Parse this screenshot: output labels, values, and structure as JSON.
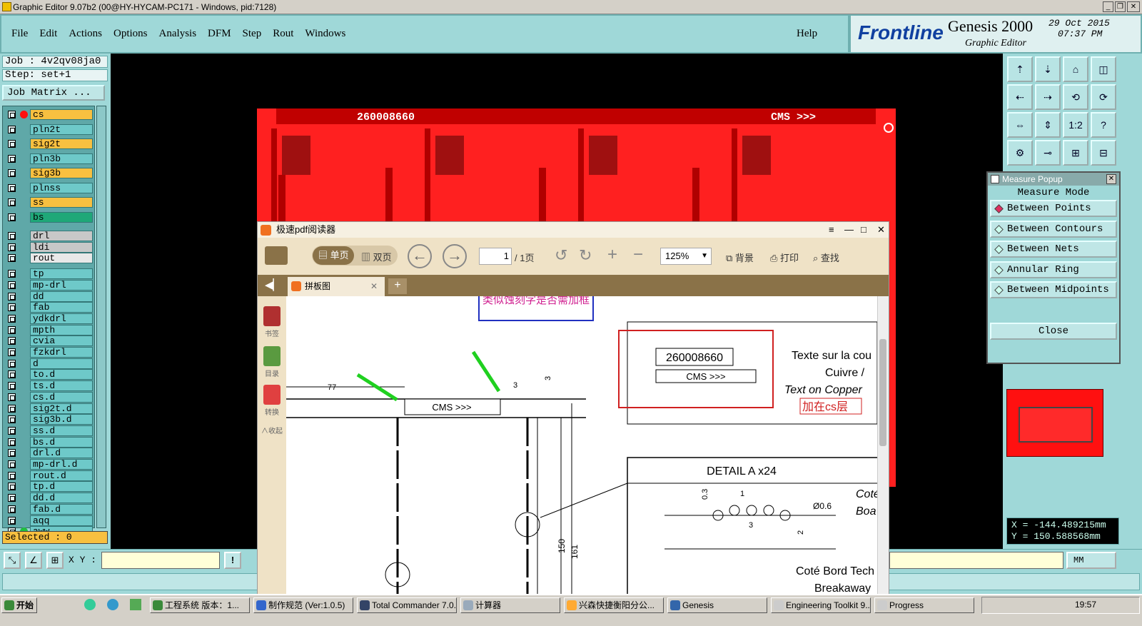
{
  "window": {
    "title": "Graphic Editor 9.07b2 (00@HY-HYCAM-PC171 - Windows, pid:7128)"
  },
  "menu": {
    "items": [
      "File",
      "Edit",
      "Actions",
      "Options",
      "Analysis",
      "DFM",
      "Step",
      "Rout",
      "Windows"
    ],
    "help": "Help"
  },
  "brand": {
    "logo": "Frontline",
    "product": "Genesis 2000",
    "subtitle": "Graphic Editor",
    "date": "29 Oct 2015",
    "time": "07:37 PM"
  },
  "job": {
    "job_line": "Job : 4v2qv08ja0",
    "step_line": "Step: set+1",
    "matrix_button": "Job Matrix ..."
  },
  "layers": [
    {
      "name": "cs",
      "color": "#f8c040"
    },
    {
      "name": "pln2t",
      "color": "#6ec9c9"
    },
    {
      "name": "sig2t",
      "color": "#f8c040"
    },
    {
      "name": "pln3b",
      "color": "#6ec9c9"
    },
    {
      "name": "sig3b",
      "color": "#f8c040"
    },
    {
      "name": "plnss",
      "color": "#6ec9c9"
    },
    {
      "name": "ss",
      "color": "#f8c040"
    },
    {
      "name": "bs",
      "color": "#1fa878"
    },
    {
      "name": "drl",
      "color": "#c8c8c8"
    },
    {
      "name": "ldi",
      "color": "#c8c8c8"
    },
    {
      "name": "rout",
      "color": "#e8e8e8"
    },
    {
      "name": "tp",
      "color": "#6ec9c9"
    },
    {
      "name": "mp-drl",
      "color": "#6ec9c9"
    },
    {
      "name": "dd",
      "color": "#6ec9c9"
    },
    {
      "name": "fab",
      "color": "#6ec9c9"
    },
    {
      "name": "ydkdrl",
      "color": "#6ec9c9"
    },
    {
      "name": "mpth",
      "color": "#6ec9c9"
    },
    {
      "name": "cvia",
      "color": "#6ec9c9"
    },
    {
      "name": "fzkdrl",
      "color": "#6ec9c9"
    },
    {
      "name": "d",
      "color": "#6ec9c9"
    },
    {
      "name": "to.d",
      "color": "#6ec9c9"
    },
    {
      "name": "ts.d",
      "color": "#6ec9c9"
    },
    {
      "name": "cs.d",
      "color": "#6ec9c9"
    },
    {
      "name": "sig2t.d",
      "color": "#6ec9c9"
    },
    {
      "name": "sig3b.d",
      "color": "#6ec9c9"
    },
    {
      "name": "ss.d",
      "color": "#6ec9c9"
    },
    {
      "name": "bs.d",
      "color": "#6ec9c9"
    },
    {
      "name": "drl.d",
      "color": "#6ec9c9"
    },
    {
      "name": "mp-drl.d",
      "color": "#6ec9c9"
    },
    {
      "name": "rout.d",
      "color": "#6ec9c9"
    },
    {
      "name": "tp.d",
      "color": "#6ec9c9"
    },
    {
      "name": "dd.d",
      "color": "#6ec9c9"
    },
    {
      "name": "fab.d",
      "color": "#6ec9c9"
    },
    {
      "name": "aqq",
      "color": "#6ec9c9"
    },
    {
      "name": "aww",
      "color": "#6ec9c9"
    }
  ],
  "selected": "Selected : 0",
  "board": {
    "left_text": "260008660",
    "right_text": "CMS >>>"
  },
  "tools": [
    "⇡",
    "⇣",
    "⌂",
    "◫",
    "⇠",
    "⇢",
    "⟲",
    "⟳",
    "⇔",
    "⇕",
    "1:2",
    "?",
    "⚙",
    "⊸",
    "⊞",
    "⊟"
  ],
  "measure": {
    "title": "Measure Popup",
    "mode_label": "Measure Mode",
    "options": [
      "Between Points",
      "Between Contours",
      "Between Nets",
      "Annular Ring",
      "Between Midpoints"
    ],
    "close": "Close"
  },
  "coords": {
    "x": "X = -144.489215mm",
    "y": "Y = 150.588568mm"
  },
  "xy": {
    "label": "X Y :",
    "units": "MM"
  },
  "pdf": {
    "title": "极速pdf阅读器",
    "single": "单页",
    "double": "双页",
    "page": "1",
    "pages": "/ 1页",
    "zoom": "125%",
    "bg": "背景",
    "print": "打印",
    "find": "查找",
    "tab": "拼板图",
    "side": [
      "书签",
      "目录",
      "转换",
      "收起"
    ],
    "note": "类似蚀刻字是否需加框",
    "box_num": "260008660",
    "box_cms": "CMS  >>>",
    "text_fr1": "Texte sur la cou",
    "text_fr2": "Cuivre /",
    "text_en": "Text on  Copper",
    "add_cs": "加在cs层",
    "detail": "DETAIL A  x24",
    "dim_77": "77",
    "dim_3a": "3",
    "dim_3b": "3",
    "dim_150": "150",
    "dim_161": "161",
    "dim_03": "0.3",
    "dim_1": "1",
    "dim_3c": "3",
    "dim_2": "2",
    "dim_d06": "Ø0.6",
    "cms_drawing": "CMS   >>>",
    "cote_a": "Coté",
    "boa": "Boa",
    "cote_bord": "Coté Bord Tech",
    "breakaway": "Breakaway"
  },
  "taskbar": {
    "start": "开始",
    "tasks": [
      "工程系统  版本：1...",
      "制作规范 (Ver:1.0.5)",
      "Total Commander 7.0...",
      "计算器",
      "兴森快捷衡阳分公...",
      "Genesis",
      "Engineering Toolkit 9....",
      "Progress"
    ],
    "clock": "19:57"
  }
}
